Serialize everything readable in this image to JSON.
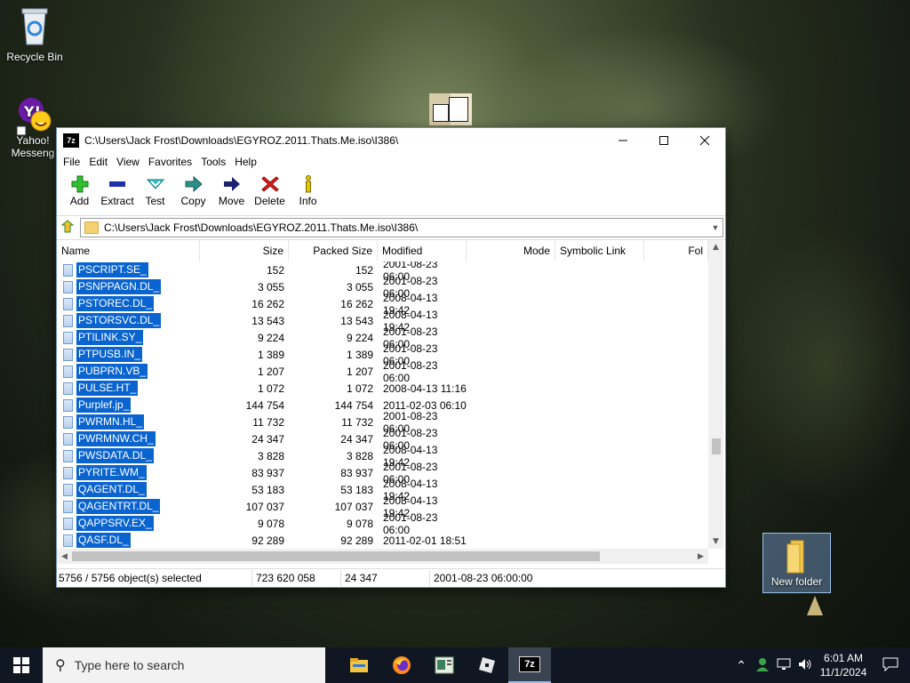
{
  "desktop": {
    "icons": [
      {
        "label": "Recycle Bin"
      },
      {
        "label": "Yahoo!\nMessenger",
        "short": "Yahoo! Messeng"
      },
      {
        "label": "New folder"
      }
    ]
  },
  "window": {
    "title": "C:\\Users\\Jack Frost\\Downloads\\EGYROZ.2011.Thats.Me.iso\\I386\\",
    "app_icon_text": "7z",
    "menu": [
      "File",
      "Edit",
      "View",
      "Favorites",
      "Tools",
      "Help"
    ],
    "toolbar": [
      "Add",
      "Extract",
      "Test",
      "Copy",
      "Move",
      "Delete",
      "Info"
    ],
    "address": "C:\\Users\\Jack Frost\\Downloads\\EGYROZ.2011.Thats.Me.iso\\I386\\",
    "columns": [
      "Name",
      "Size",
      "Packed Size",
      "Modified",
      "Mode",
      "Symbolic Link",
      "Fol"
    ],
    "rows": [
      {
        "name": "PSCRIPT.SE_",
        "size": "152",
        "packed": "152",
        "modified": "2001-08-23 06:00"
      },
      {
        "name": "PSNPPAGN.DL_",
        "size": "3 055",
        "packed": "3 055",
        "modified": "2001-08-23 06:00"
      },
      {
        "name": "PSTOREC.DL_",
        "size": "16 262",
        "packed": "16 262",
        "modified": "2008-04-13 19:42"
      },
      {
        "name": "PSTORSVC.DL_",
        "size": "13 543",
        "packed": "13 543",
        "modified": "2008-04-13 19:42"
      },
      {
        "name": "PTILINK.SY_",
        "size": "9 224",
        "packed": "9 224",
        "modified": "2001-08-23 06:00"
      },
      {
        "name": "PTPUSB.IN_",
        "size": "1 389",
        "packed": "1 389",
        "modified": "2001-08-23 06:00"
      },
      {
        "name": "PUBPRN.VB_",
        "size": "1 207",
        "packed": "1 207",
        "modified": "2001-08-23 06:00"
      },
      {
        "name": "PULSE.HT_",
        "size": "1 072",
        "packed": "1 072",
        "modified": "2008-04-13 11:16"
      },
      {
        "name": "Purplef.jp_",
        "size": "144 754",
        "packed": "144 754",
        "modified": "2011-02-03 06:10"
      },
      {
        "name": "PWRMN.HL_",
        "size": "11 732",
        "packed": "11 732",
        "modified": "2001-08-23 06:00"
      },
      {
        "name": "PWRMNW.CH_",
        "size": "24 347",
        "packed": "24 347",
        "modified": "2001-08-23 06:00"
      },
      {
        "name": "PWSDATA.DL_",
        "size": "3 828",
        "packed": "3 828",
        "modified": "2008-04-13 19:42"
      },
      {
        "name": "PYRITE.WM_",
        "size": "83 937",
        "packed": "83 937",
        "modified": "2001-08-23 06:00"
      },
      {
        "name": "QAGENT.DL_",
        "size": "53 183",
        "packed": "53 183",
        "modified": "2008-04-13 19:42"
      },
      {
        "name": "QAGENTRT.DL_",
        "size": "107 037",
        "packed": "107 037",
        "modified": "2008-04-13 19:42"
      },
      {
        "name": "QAPPSRV.EX_",
        "size": "9 078",
        "packed": "9 078",
        "modified": "2001-08-23 06:00"
      },
      {
        "name": "QASF.DL_",
        "size": "92 289",
        "packed": "92 289",
        "modified": "2011-02-01 18:51"
      }
    ],
    "status": {
      "selected": "5756 / 5756 object(s) selected",
      "total_size": "723 620 058",
      "item_size": "24 347",
      "item_modified": "2001-08-23 06:00:00"
    }
  },
  "taskbar": {
    "search_placeholder": "Type here to search",
    "apps": [
      "file-explorer",
      "firefox",
      "app-window",
      "roblox",
      "7-zip"
    ],
    "time": "6:01 AM",
    "date": "11/1/2024"
  }
}
